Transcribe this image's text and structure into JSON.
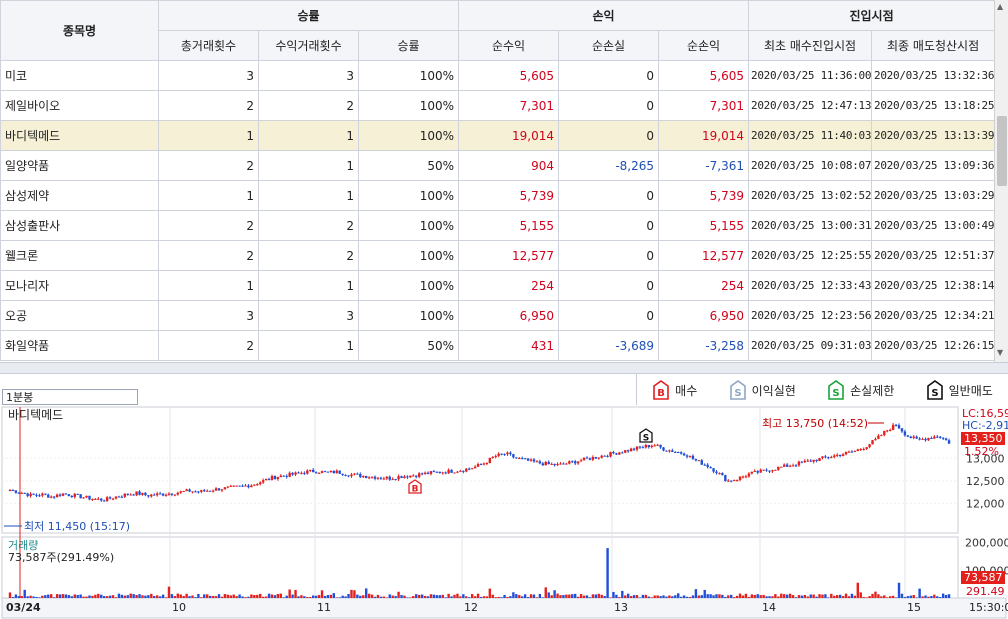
{
  "table": {
    "group_headers": {
      "name": "종목명",
      "winrate": "승률",
      "pnl": "손익",
      "entry": "진입시점"
    },
    "columns": [
      "총거래횟수",
      "수익거래횟수",
      "승률",
      "순수익",
      "순손실",
      "순손익",
      "최초 매수진입시점",
      "최종 매도청산시점"
    ],
    "rows": [
      {
        "name": "미코",
        "total": "3",
        "wins": "3",
        "rate": "100%",
        "profit": "5,605",
        "loss": "0",
        "net": "5,605",
        "net_sign": "pos",
        "first": "2020/03/25 11:36:00",
        "last": "2020/03/25 13:32:36"
      },
      {
        "name": "제일바이오",
        "total": "2",
        "wins": "2",
        "rate": "100%",
        "profit": "7,301",
        "loss": "0",
        "net": "7,301",
        "net_sign": "pos",
        "first": "2020/03/25 12:47:13",
        "last": "2020/03/25 13:18:25"
      },
      {
        "name": "바디텍메드",
        "total": "1",
        "wins": "1",
        "rate": "100%",
        "profit": "19,014",
        "loss": "0",
        "net": "19,014",
        "net_sign": "pos",
        "first": "2020/03/25 11:40:03",
        "last": "2020/03/25 13:13:39",
        "selected": true
      },
      {
        "name": "일양약품",
        "total": "2",
        "wins": "1",
        "rate": "50%",
        "profit": "904",
        "loss": "-8,265",
        "net": "-7,361",
        "net_sign": "neg",
        "first": "2020/03/25 10:08:07",
        "last": "2020/03/25 13:09:36"
      },
      {
        "name": "삼성제약",
        "total": "1",
        "wins": "1",
        "rate": "100%",
        "profit": "5,739",
        "loss": "0",
        "net": "5,739",
        "net_sign": "pos",
        "first": "2020/03/25 13:02:52",
        "last": "2020/03/25 13:03:29"
      },
      {
        "name": "삼성출판사",
        "total": "2",
        "wins": "2",
        "rate": "100%",
        "profit": "5,155",
        "loss": "0",
        "net": "5,155",
        "net_sign": "pos",
        "first": "2020/03/25 13:00:31",
        "last": "2020/03/25 13:00:49"
      },
      {
        "name": "웰크론",
        "total": "2",
        "wins": "2",
        "rate": "100%",
        "profit": "12,577",
        "loss": "0",
        "net": "12,577",
        "net_sign": "pos",
        "first": "2020/03/25 12:25:55",
        "last": "2020/03/25 12:51:37"
      },
      {
        "name": "모나리자",
        "total": "1",
        "wins": "1",
        "rate": "100%",
        "profit": "254",
        "loss": "0",
        "net": "254",
        "net_sign": "pos",
        "first": "2020/03/25 12:33:43",
        "last": "2020/03/25 12:38:14"
      },
      {
        "name": "오공",
        "total": "3",
        "wins": "3",
        "rate": "100%",
        "profit": "6,950",
        "loss": "0",
        "net": "6,950",
        "net_sign": "pos",
        "first": "2020/03/25 12:23:56",
        "last": "2020/03/25 12:34:21"
      },
      {
        "name": "화일약품",
        "total": "2",
        "wins": "1",
        "rate": "50%",
        "profit": "431",
        "loss": "-3,689",
        "net": "-3,258",
        "net_sign": "neg",
        "first": "2020/03/25 09:31:03",
        "last": "2020/03/25 12:26:15"
      }
    ]
  },
  "chart_toolbar": {
    "timeframe": "1분봉",
    "legend": [
      {
        "label": "매수",
        "glyph": "B",
        "color": "#e02020"
      },
      {
        "label": "이익실현",
        "glyph": "S",
        "color": "#8fa6c4"
      },
      {
        "label": "손실제한",
        "glyph": "S",
        "color": "#1aa33a"
      },
      {
        "label": "일반매도",
        "glyph": "S",
        "color": "#111111"
      }
    ]
  },
  "colors": {
    "up": "#e3201b",
    "down": "#1f4fd8",
    "header_bg": "#f3f5f9",
    "selected_row": "#f6f1d6"
  },
  "chart_data": {
    "type": "candlestick",
    "title": "바디텍메드",
    "x_labels": [
      "03/24",
      "10",
      "11",
      "12",
      "13",
      "14",
      "15",
      "15:30:0"
    ],
    "y_ticks": [
      "12,000",
      "12,500",
      "13,000"
    ],
    "ylim": [
      11400,
      16600
    ],
    "price_panel_labels": {
      "lc": "LC:16,59",
      "hc": "HC:-2,91",
      "last": "13,350",
      "pct": "1.52%"
    },
    "high_annotation": "최고 13,750 (14:52)",
    "low_annotation": "최저 11,450 (15:17)",
    "trade_markers": [
      {
        "type": "B",
        "label": "B"
      },
      {
        "type": "S",
        "label": "S"
      }
    ],
    "close_path": [
      12300,
      12250,
      12180,
      12200,
      12150,
      12220,
      12180,
      12140,
      12100,
      12080,
      12150,
      12200,
      12230,
      12180,
      12200,
      12220,
      12250,
      12280,
      12260,
      12300,
      12330,
      12350,
      12380,
      12420,
      12500,
      12580,
      12620,
      12650,
      12700,
      12720,
      12680,
      12700,
      12650,
      12620,
      12600,
      12580,
      12560,
      12600,
      12620,
      12650,
      12680,
      12700,
      12720,
      12750,
      12800,
      12900,
      13050,
      13100,
      13000,
      12950,
      12900,
      12870,
      12850,
      12900,
      12950,
      13000,
      13050,
      13100,
      13150,
      13200,
      13250,
      13300,
      13200,
      13150,
      13100,
      12950,
      12850,
      12700,
      12500,
      12550,
      12650,
      12700,
      12750,
      12800,
      12850,
      12900,
      12950,
      13000,
      13050,
      13100,
      13150,
      13250,
      13400,
      13600,
      13750,
      13500,
      13400,
      13450,
      13500,
      13350
    ],
    "volume": {
      "label": "거래량",
      "value_text": "73,587주(291.49%)",
      "y_ticks": [
        "200,000",
        "100,000"
      ],
      "ylim": [
        0,
        220000
      ],
      "last_label": "73,587",
      "last_pct": "291.49"
    }
  }
}
